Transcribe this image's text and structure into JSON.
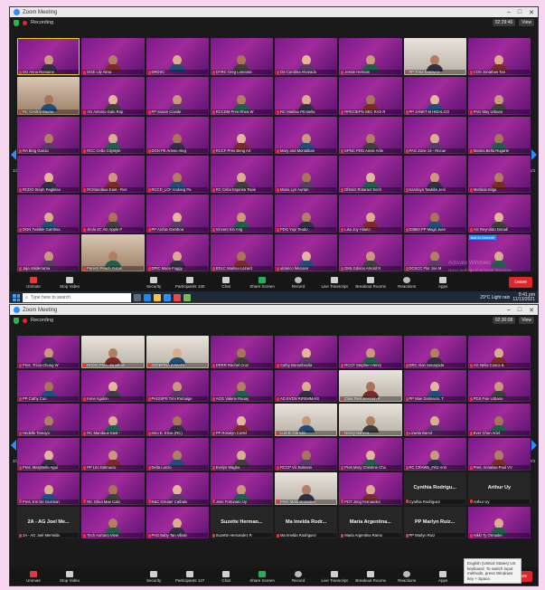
{
  "window1": {
    "title": "Zoom Meeting",
    "recording": "Recording",
    "time": "02:29:46",
    "view": "View",
    "page_left": "1/3",
    "page_right": "1/3",
    "participants": [
      "DG Anna Romaine",
      "DGE Lily Alma",
      "DRDSC",
      "DYRC Greg Lomanta",
      "DS Carolina Alvarado",
      "Jessie Herman",
      "PP Trina Dasayco",
      "COS Jonathan Tan",
      "RC Central Davao",
      "AG Antonio Galo Rop",
      "PP Susan Covide",
      "RCCDM Pres Rhea W",
      "RC Marilao PD Bella",
      "RPEC/EPN SEC RAS R",
      "PP JANET M HIDALGO",
      "PAG May Urbano",
      "RA Bing Garcia",
      "RCC Cebu Citystyle",
      "DGN PE Arlene Aleg",
      "RCCF Pres Beng Art",
      "Mary and Montalban",
      "EPNC PDG Annie Arlie",
      "PAG Zone 14 - Recue",
      "Marina Bella Rugarte",
      "RCDO Steph Pagbilao",
      "RCMandaue East - Ros",
      "RCCD_LCF Andang Pa",
      "RC Cebu Espinita Tepie",
      "Maria Lyn Aurtan",
      "Dfstrict Rotaract Sech",
      "Karolaya 'Mabilis Jeni",
      "Marlada Bilga",
      "DGN Twinkle Gamboa",
      "Jimla 3C AG Apple P",
      "PP Archie Gamboa",
      "Vincent Kin Ang",
      "PDG Yuyi Teodo",
      "Lisa Joy Hilario",
      "D3850 PP Magli Juan",
      "AG Reynoldo Doradi",
      "Jaja Valderrama",
      "Parenti Peach Yuzon",
      "DPIC Marvi Foggy",
      "EDLC Marilou Lazard",
      "uldarico feliciano",
      "DML Edison Arnold N",
      "DCSCC Flor Joe M",
      "Ask to Unmute"
    ],
    "toolbar": {
      "unmute": "Unmute",
      "stop_video": "Stop Video",
      "security": "Security",
      "participants": "Participants",
      "participants_count": "130",
      "chat": "Chat",
      "share_screen": "Share Screen",
      "record": "Record",
      "live_transcript": "Live Transcript",
      "breakout_rooms": "Breakout Rooms",
      "reactions": "Reactions",
      "apps": "Apps",
      "leave": "Leave"
    },
    "watermark_line1": "Activate Windows",
    "watermark_line2": "Go to Settings to activate Windows.",
    "taskbar": {
      "search_placeholder": "Type here to search",
      "weather": "29°C Light rain",
      "time": "8:41 pm",
      "date": "11/13/2021"
    }
  },
  "window2": {
    "title": "Zoom Meeting",
    "recording": "Recording",
    "time": "02:30:08",
    "view": "View",
    "page_left": "2/3",
    "page_right": "2/3",
    "participants": [
      "Pres. Tricia Chung W",
      "RCMC Pres. Jonathan",
      "JOSEFINA ZABATE",
      "DRRR Rachel Cruz",
      "Cathy Bonaribactia",
      "RCCF Stephen Henry",
      "DRC Alan Senarpida",
      "AG Nelia Cosca &",
      "PP Cathy Cuo",
      "Irene Agulon",
      "PAG/SPS Trini Romaige",
      "AGG Valerie Rauay",
      "AD EVDN RIFEMMAIS",
      "Ziaar Resurreccion R",
      "PP Mae Dalmacio, T.",
      "PDS Fvie Urbano",
      "Hedelle Tamayo",
      "RC Mandaue East -",
      "Inno E. Ernie (RC)",
      "PP Rosalyn Cortel",
      "Luis B. Carlobit",
      "Nancy Barrera",
      "Lizarita Barrol",
      "Ever Chan Ariel",
      "Pres. MaryBelle Agui",
      "PP Lito Dalmacio",
      "Della Lanzo",
      "Evelyn Magbo",
      "RCCP Vic Bulosan",
      "Pres Mary Christine Cha",
      "RC CRAWE_Fritz Ann",
      "Pres. Annalisa Paul VV",
      "Pres. Em De Guzman",
      "Rtr. Glina Mae Cabi",
      "R&C Greater Catbalo",
      "Jose Fortunato Uy",
      "Pres. Malu Gonzales",
      "PDT Jong Fernandez",
      "Cynthia Rodriguez",
      "Arthur Uy",
      "2A - AG Joel Mermida",
      "Tech Aurturia View",
      "PAG Baby Tan Villalo",
      "Suzette Hernandez R",
      "Ma Imelda Rodriguez",
      "Maria Argentina Ramo",
      "PP Marlyn Ruiz",
      "Nikki Ty Ormadei"
    ],
    "big_names": {
      "38": "Cynthia Rodrigu...",
      "39": "Arthur Uy",
      "40": "2A - AG Joel Me...",
      "43": "Suzette Herman...",
      "44": "Ma Imelda Rodr...",
      "45": "Maria Argentina...",
      "46": "PP Marlyn Ruiz..."
    },
    "toolbar": {
      "unmute": "Unmute",
      "stop_video": "Stop Video",
      "security": "Security",
      "participants": "Participants",
      "participants_count": "127",
      "chat": "Chat",
      "share_screen": "Share Screen",
      "record": "Record",
      "live_transcript": "Live Transcript",
      "breakout_rooms": "Breakout Rooms",
      "reactions": "Reactions",
      "apps": "Apps",
      "leave": "Leave"
    },
    "tooltip": "English (United States) US keyboard. To switch input methods, press Windows key + Space."
  },
  "colors": {
    "tile_bg": "#8a1f93",
    "leave": "#e0262c",
    "accent": "#2d8cff",
    "active_speaker": "#f3d000"
  }
}
